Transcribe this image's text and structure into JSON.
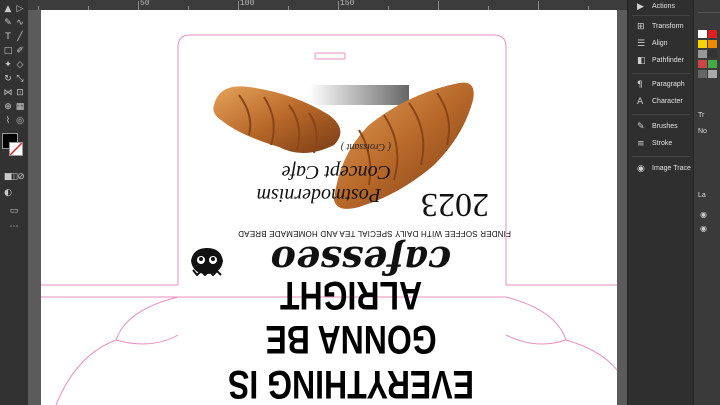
{
  "ruler": {
    "labels": [
      "50",
      "100",
      "150"
    ]
  },
  "panel": {
    "items": [
      {
        "label": "Actions",
        "icon": "play-icon"
      },
      {
        "label": "Transform",
        "icon": "transform-icon"
      },
      {
        "label": "Align",
        "icon": "align-icon"
      },
      {
        "label": "Pathfinder",
        "icon": "pathfinder-icon"
      },
      {
        "label": "Paragraph",
        "icon": "paragraph-icon"
      },
      {
        "label": "Character",
        "icon": "character-icon"
      },
      {
        "label": "Brushes",
        "icon": "brush-icon"
      },
      {
        "label": "Stroke",
        "icon": "stroke-icon"
      },
      {
        "label": "Image Trace",
        "icon": "image-trace-icon"
      }
    ]
  },
  "panel2": {
    "labels": [
      "Tr",
      "No",
      "La"
    ]
  },
  "design": {
    "headline_line1": "GONNA BE ALRIGHT",
    "headline_line2": "EVERYTHING IS",
    "brand": "cafesseo",
    "tagline": "FINDER SOFFEE WITH DAILY SPECIAL TEA AND HOMEMADE BREAD",
    "year": "2023",
    "concept_line1": "Postmodernism",
    "concept_line2": "Concept Cafe",
    "sub": "( Croissant )"
  },
  "colors": {
    "canvas": "#5b5b5b",
    "artboard": "#ffffff",
    "dieline": "#e88fc0",
    "ui_dark": "#323232"
  }
}
